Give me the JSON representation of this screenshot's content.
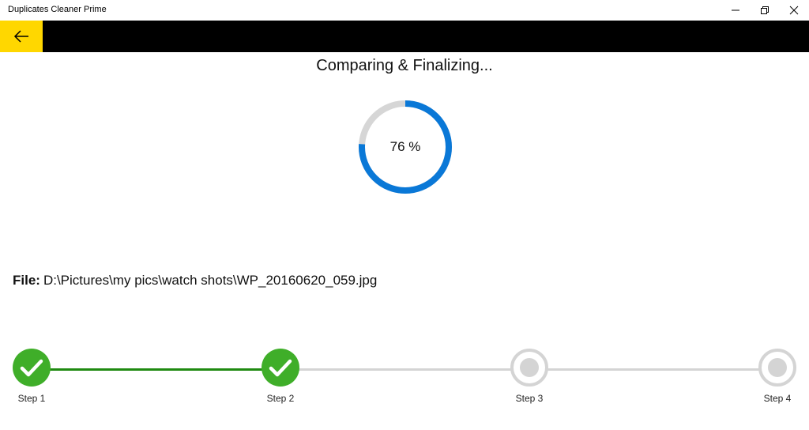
{
  "window": {
    "title": "Duplicates Cleaner Prime"
  },
  "header": {
    "accent_color": "#ffd700",
    "back_icon": "arrow-left-icon"
  },
  "status": {
    "title": "Comparing & Finalizing...",
    "progress_percent": 76,
    "progress_text": "76 %",
    "progress_color": "#0a78d7",
    "track_color": "#d6d6d6"
  },
  "file": {
    "label": "File:",
    "path": "D:\\Pictures\\my pics\\watch shots\\WP_20160620_059.jpg"
  },
  "steps": [
    {
      "label": "Step 1",
      "state": "done"
    },
    {
      "label": "Step 2",
      "state": "done"
    },
    {
      "label": "Step 3",
      "state": "pending"
    },
    {
      "label": "Step 4",
      "state": "pending"
    }
  ],
  "colors": {
    "done": "#3fae29",
    "done_line": "#1f8a11",
    "pending": "#d4d4d4"
  }
}
